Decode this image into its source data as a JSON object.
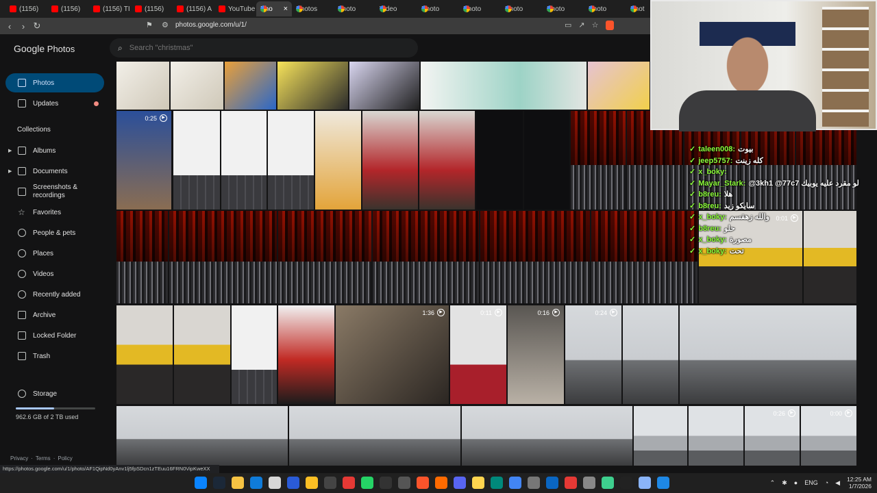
{
  "browser": {
    "tabs": [
      {
        "label": "(1156)",
        "kind": "yt"
      },
      {
        "label": "(1156)",
        "kind": "yt"
      },
      {
        "label": "(1156) TI",
        "kind": "yt"
      },
      {
        "label": "(1156)",
        "kind": "yt"
      },
      {
        "label": "(1156) A",
        "kind": "yt"
      },
      {
        "label": "YouTube",
        "kind": "yt"
      },
      {
        "label": "Pho",
        "kind": "ph",
        "active": true
      },
      {
        "label": "Photos",
        "kind": "ph"
      },
      {
        "label": "Photo",
        "kind": "ph"
      },
      {
        "label": "Video",
        "kind": "ph"
      },
      {
        "label": "Photo",
        "kind": "ph"
      },
      {
        "label": "Photo",
        "kind": "ph"
      },
      {
        "label": "Photo",
        "kind": "ph"
      },
      {
        "label": "Photo",
        "kind": "ph"
      },
      {
        "label": "Photo",
        "kind": "ph"
      },
      {
        "label": "Phot",
        "kind": "ph"
      }
    ],
    "url": "photos.google.com/u/1/",
    "status_url": "https://photos.google.com/u/1/photo/AF1QipNd0yAnv1lj5fpSDcn1zTEuu16FRN0VipKweXX"
  },
  "app": {
    "logo_google": "Google",
    "logo_photos": "Photos",
    "search_placeholder": "Search \"christmas\""
  },
  "sidebar": {
    "photos": "Photos",
    "updates": "Updates",
    "collections": "Collections",
    "albums": "Albums",
    "documents": "Documents",
    "screenshots": "Screenshots &",
    "recordings": "recordings",
    "favorites": "Favorites",
    "people": "People & pets",
    "places": "Places",
    "videos": "Videos",
    "recently_added": "Recently added",
    "archive": "Archive",
    "locked": "Locked Folder",
    "trash": "Trash",
    "storage": "Storage",
    "storage_used": "962.6 GB of 2 TB used",
    "storage_fraction": 0.48,
    "privacy": "Privacy",
    "terms": "Terms",
    "policy": "Policy",
    "sep": "·"
  },
  "durations": {
    "d1": "0:25",
    "d2": "0:01",
    "d3": "1:36",
    "d4": "0:11",
    "d5": "0:16",
    "d6": "0:24",
    "d7": "0:26",
    "d8": "0:00"
  },
  "chat": [
    {
      "user": "taleen008:",
      "msg": "بيوت"
    },
    {
      "user": "jeep5757:",
      "msg": "كله زينت"
    },
    {
      "user": "x_boky:",
      "msg": ""
    },
    {
      "user": "Mayar_Stark:",
      "msg": "@3kh1 @77c7 لو مقرد عليه يوبيك"
    },
    {
      "user": "b8reu:",
      "msg": "هلا"
    },
    {
      "user": "b8reu:",
      "msg": "سايكو زيد"
    },
    {
      "user": "x_boky:",
      "msg": "والله زهقسم"
    },
    {
      "user": "b8reu:",
      "msg": "حلو"
    },
    {
      "user": "x_boky:",
      "msg": "مصورة"
    },
    {
      "user": "x_boky:",
      "msg": "تحت"
    }
  ],
  "taskbar": {
    "lang": "ENG",
    "time": "12:25 AM",
    "date": "1/7/2026"
  }
}
